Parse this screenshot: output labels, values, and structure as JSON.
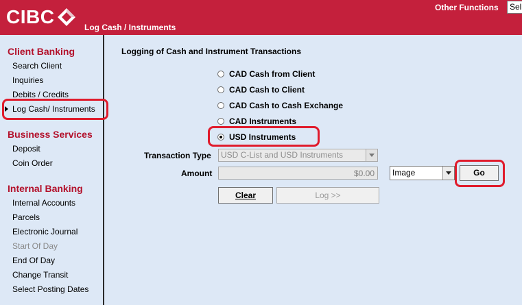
{
  "header": {
    "logo_text": "CIBC",
    "page_title": "Log Cash / Instruments",
    "other_functions": "Other Functions",
    "select_value": "Sel",
    "brand_color": "#c4203c"
  },
  "sidebar": {
    "client_banking": {
      "title": "Client Banking",
      "items": [
        "Search Client",
        "Inquiries",
        "Debits / Credits",
        "Log Cash/ Instruments"
      ]
    },
    "business_services": {
      "title": "Business Services",
      "items": [
        "Deposit",
        "Coin Order"
      ]
    },
    "internal_banking": {
      "title": "Internal Banking",
      "items": [
        "Internal Accounts",
        "Parcels",
        "Electronic Journal",
        "Start Of Day",
        "End Of Day",
        "Change Transit",
        "Select Posting Dates"
      ]
    },
    "active_item": "Log Cash/ Instruments",
    "disabled_item": "Start Of Day"
  },
  "main": {
    "title": "Logging of Cash and Instrument Transactions",
    "options": [
      "CAD Cash from Client",
      "CAD Cash to Client",
      "CAD Cash to Cash Exchange",
      "CAD Instruments",
      "USD Instruments"
    ],
    "selected_option": "USD Instruments",
    "transaction_type_label": "Transaction Type",
    "transaction_type_value": "USD C-List and USD Instruments",
    "amount_label": "Amount",
    "amount_value": "$0.00",
    "image_select_value": "Image",
    "go_label": "Go",
    "clear_label": "Clear",
    "log_label": "Log >>"
  },
  "colors": {
    "background": "#dde8f6",
    "section_title": "#b3112b",
    "highlight": "#e01b2c"
  }
}
